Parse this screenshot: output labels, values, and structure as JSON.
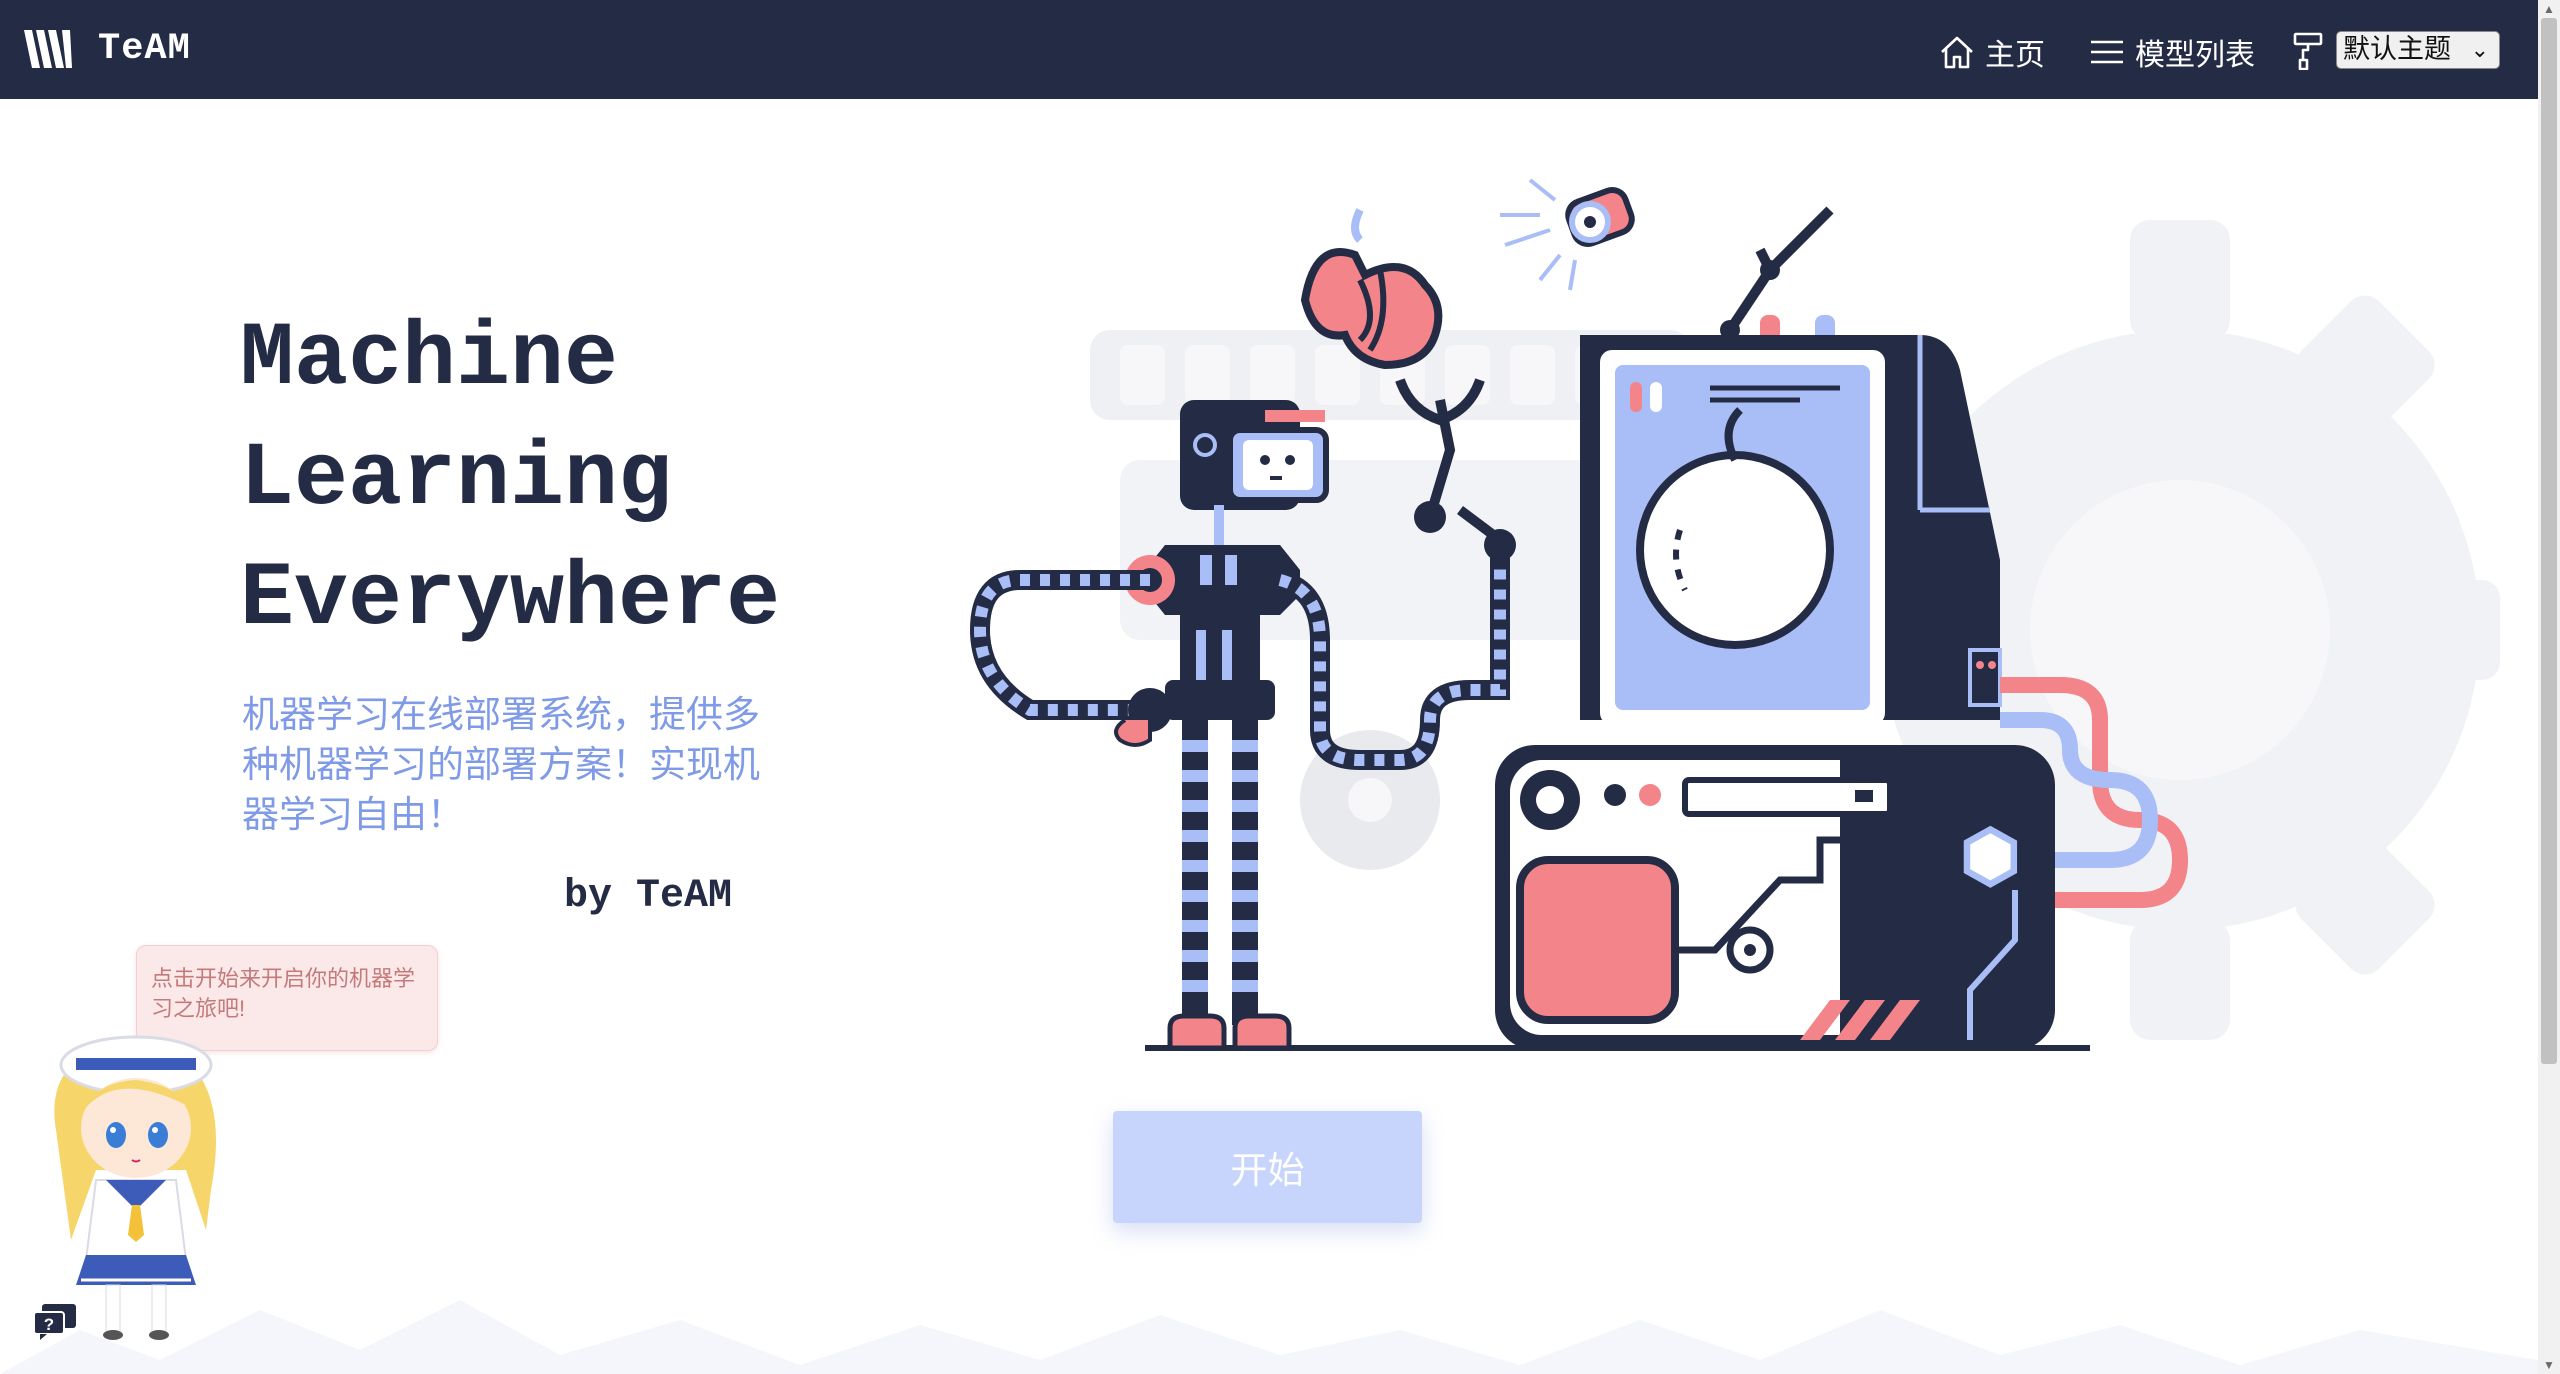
{
  "navbar": {
    "brand": "TeAM",
    "home_label": "主页",
    "models_label": "模型列表",
    "theme_selected": "默认主题"
  },
  "hero": {
    "title_lines": [
      "Machine",
      "Learning",
      "Everywhere"
    ],
    "subtitle": "机器学习在线部署系统，提供多种机器学习的部署方案！实现机器学习自由！",
    "byline": "by TeAM"
  },
  "start_button": "开始",
  "mascot": {
    "tip": "点击开始来开启你的机器学习之旅吧!"
  },
  "icons": {
    "home": "home-icon",
    "menu": "menu-icon",
    "theme": "paint-roller-icon",
    "help": "help-chat-icon"
  },
  "colors": {
    "navbar": "#242b44",
    "accent_blue": "#7f9ae6",
    "accent_coral": "#f2848a",
    "button": "#c7d4fb"
  }
}
